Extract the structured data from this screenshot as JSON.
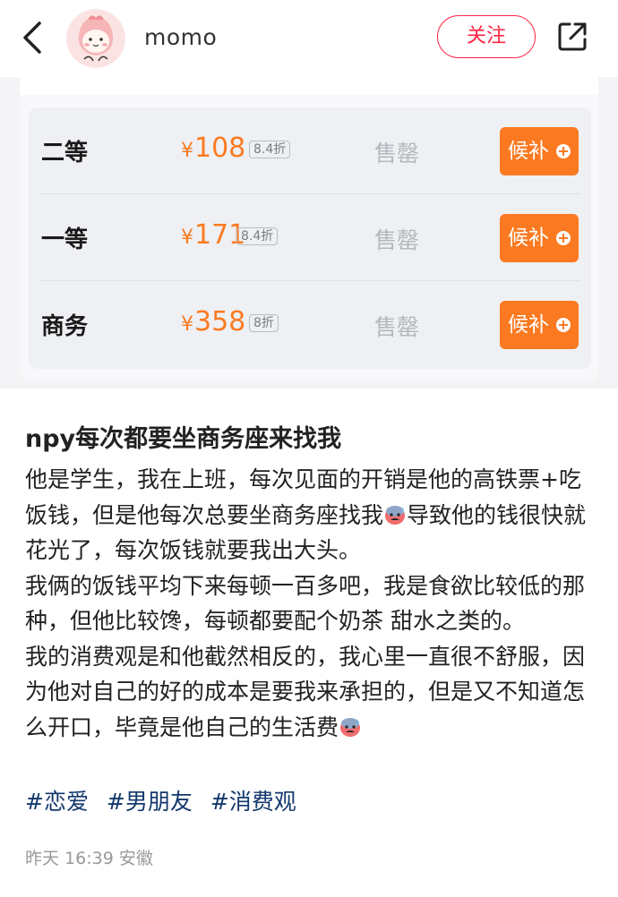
{
  "header": {
    "username": "momo",
    "follow_label": "关注"
  },
  "fare_table": {
    "rows": [
      {
        "seat_class": "二等",
        "currency": "¥",
        "price": "108",
        "discount": "8.4折",
        "status": "售罄",
        "action": "候补"
      },
      {
        "seat_class": "一等",
        "currency": "¥",
        "price": "171",
        "discount": "8.4折",
        "status": "售罄",
        "action": "候补"
      },
      {
        "seat_class": "商务",
        "currency": "¥",
        "price": "358",
        "discount": "8折",
        "status": "售罄",
        "action": "候补"
      }
    ]
  },
  "post": {
    "title": "npy每次都要坐商务座来找我",
    "paragraphs": [
      "他是学生，我在上班，每次见面的开销是他的高铁票+吃饭钱，但是他每次总要坐商务座找我",
      "导致他的钱很快就花光了，每次饭钱就要我出大头。",
      "我俩的饭钱平均下来每顿一百多吧，我是食欲比较低的那种，但他比较馋，每顿都要配个奶茶 甜水之类的。",
      "我的消费观是和他截然相反的，我心里一直很不舒服，因为他对自己的好的成本是要我来承担的，但是又不知道怎么开口，毕竟是他自己的生活费"
    ],
    "tags": [
      "#恋爱",
      "#男朋友",
      "#消费观"
    ],
    "time": "昨天 16:39",
    "location": "安徽"
  },
  "icons": {
    "back": "chevron-left-icon",
    "share": "share-icon",
    "waitlist_plus": "plus-circle-icon",
    "emoji": "sweat-face-emoji-icon"
  },
  "colors": {
    "accent_red": "#ff2442",
    "price_orange": "#fb7a21",
    "tag_blue": "#13386c",
    "muted_gray": "#999999"
  }
}
